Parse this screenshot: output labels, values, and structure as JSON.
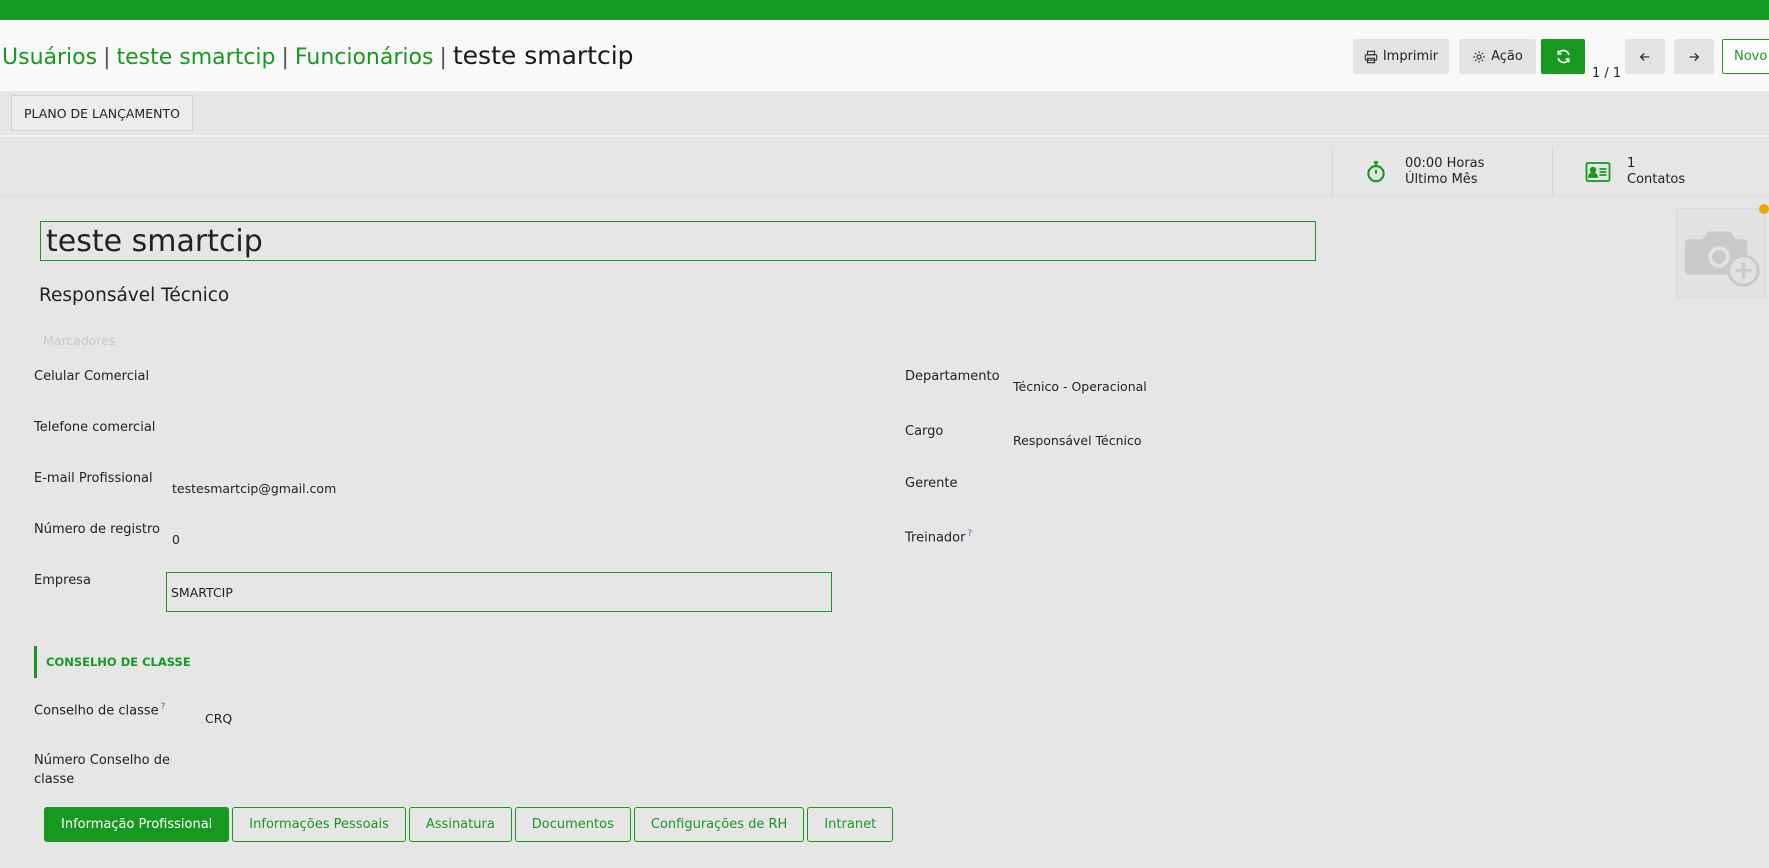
{
  "breadcrumb": {
    "items": [
      "Usuários",
      "teste smartcip",
      "Funcionários"
    ],
    "current": "teste smartcip"
  },
  "header_actions": {
    "print": "Imprimir",
    "action": "Ação",
    "pager": "1 / 1",
    "new": "Novo"
  },
  "toolbar": {
    "plan_button": "PLANO DE LANÇAMENTO"
  },
  "stats": {
    "hours_value": "00:00 Horas",
    "hours_label": "Último Mês",
    "contacts_value": "1",
    "contacts_label": "Contatos"
  },
  "employee": {
    "name": "teste smartcip",
    "job_title": "Responsável Técnico",
    "tags_placeholder": "Marcadores"
  },
  "fields_left": {
    "mobile_label": "Celular Comercial",
    "phone_label": "Telefone comercial",
    "email_label": "E-mail Profissional",
    "email_value": "testesmartcip@gmail.com",
    "registration_label": "Número de registro",
    "registration_value": "0",
    "company_label": "Empresa",
    "company_value": "SMARTCIP"
  },
  "fields_right": {
    "department_label": "Departamento",
    "department_value": "Técnico - Operacional",
    "position_label": "Cargo",
    "position_value": "Responsável Técnico",
    "manager_label": "Gerente",
    "coach_label": "Treinador"
  },
  "council": {
    "section_title": "CONSELHO DE CLASSE",
    "council_label": "Conselho de classe",
    "council_value": "CRQ",
    "number_label_line1": "Número Conselho de",
    "number_label_line2": "classe",
    "help_mark": "?"
  },
  "tabs": [
    {
      "label": "Informação Profissional"
    },
    {
      "label": "Informações Pessoais"
    },
    {
      "label": "Assinatura"
    },
    {
      "label": "Documentos"
    },
    {
      "label": "Configurações de RH"
    },
    {
      "label": "Intranet"
    }
  ],
  "colors": {
    "brand": "#17991f",
    "topbar": "#159a22",
    "background": "#e6e6e6",
    "status_dot": "#f0a500"
  },
  "icons": [
    "printer-icon",
    "gear-icon",
    "refresh-icon",
    "arrow-left-icon",
    "arrow-right-icon",
    "stopwatch-icon",
    "id-card-icon",
    "camera-add-icon"
  ]
}
